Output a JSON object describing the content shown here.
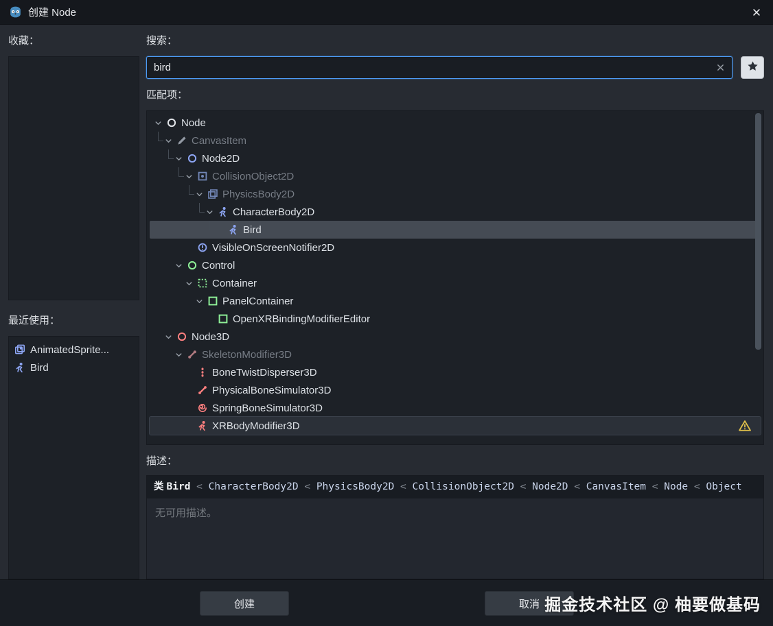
{
  "window": {
    "title": "创建 Node"
  },
  "favorites": {
    "label": "收藏："
  },
  "recent": {
    "label": "最近使用：",
    "items": [
      {
        "label": "AnimatedSprite...",
        "icon": "sprite-frames-icon",
        "color": "#8da5f3"
      },
      {
        "label": "Bird",
        "icon": "person-icon",
        "color": "#8da5f3"
      }
    ]
  },
  "search": {
    "label": "搜索：",
    "value": "bird"
  },
  "matches": {
    "label": "匹配项：",
    "rows": [
      {
        "label": "Node",
        "icon": "circle-icon",
        "color": "#e3e6ea",
        "level": 0,
        "chevron": true
      },
      {
        "label": "CanvasItem",
        "icon": "brush-icon",
        "color": "#9299a3",
        "level": 1,
        "chevron": true,
        "connector": true,
        "muted": true
      },
      {
        "label": "Node2D",
        "icon": "circle-icon",
        "color": "#8da5f3",
        "level": 2,
        "chevron": true,
        "connector": true
      },
      {
        "label": "CollisionObject2D",
        "icon": "square-circle-icon",
        "color": "#7287b8",
        "level": 3,
        "chevron": true,
        "connector": true,
        "muted": true
      },
      {
        "label": "PhysicsBody2D",
        "icon": "squares-icon",
        "color": "#7287b8",
        "level": 4,
        "chevron": true,
        "connector": true,
        "muted": true
      },
      {
        "label": "CharacterBody2D",
        "icon": "person-icon",
        "color": "#8da5f3",
        "level": 5,
        "chevron": true,
        "connector": true
      },
      {
        "label": "Bird",
        "icon": "person-icon",
        "color": "#8da5f3",
        "level": 6,
        "connector": true,
        "selected": true
      },
      {
        "label": "VisibleOnScreenNotifier2D",
        "icon": "alert-circle-icon",
        "color": "#8da5f3",
        "level": 3
      },
      {
        "label": "Control",
        "icon": "circle-icon",
        "color": "#8eef97",
        "level": 2,
        "chevron": true
      },
      {
        "label": "Container",
        "icon": "dotted-square-icon",
        "color": "#8eef97",
        "level": 3,
        "chevron": true
      },
      {
        "label": "PanelContainer",
        "icon": "square-icon",
        "color": "#8eef97",
        "level": 4,
        "chevron": true
      },
      {
        "label": "OpenXRBindingModifierEditor",
        "icon": "square-icon",
        "color": "#8eef97",
        "level": 5
      },
      {
        "label": "Node3D",
        "icon": "circle-icon",
        "color": "#fc7f7f",
        "level": 1,
        "chevron": true
      },
      {
        "label": "SkeletonModifier3D",
        "icon": "skeleton-icon",
        "color": "#b07a80",
        "level": 2,
        "chevron": true,
        "muted": true
      },
      {
        "label": "BoneTwistDisperser3D",
        "icon": "bone-stack-icon",
        "color": "#fc7f7f",
        "level": 3
      },
      {
        "label": "PhysicalBoneSimulator3D",
        "icon": "bone-icon",
        "color": "#fc7f7f",
        "level": 3
      },
      {
        "label": "SpringBoneSimulator3D",
        "icon": "spring-icon",
        "color": "#fc7f7f",
        "level": 3
      },
      {
        "label": "XRBodyModifier3D",
        "icon": "person-icon",
        "color": "#fc7f7f",
        "level": 3,
        "hover": true,
        "warning": true
      }
    ]
  },
  "description": {
    "label": "描述：",
    "class_word": "类",
    "class_name": "Bird",
    "separator": "<",
    "ancestors": [
      "CharacterBody2D",
      "PhysicsBody2D",
      "CollisionObject2D",
      "Node2D",
      "CanvasItem",
      "Node",
      "Object"
    ],
    "empty_text": "无可用描述。"
  },
  "actions": {
    "create": "创建",
    "cancel": "取消"
  },
  "watermark": "掘金技术社区 @ 柚要做基码",
  "colors": {
    "node2d_blue": "#8da5f3",
    "control_green": "#8eef97",
    "node3d_red": "#fc7f7f",
    "warning_yellow": "#e0c04a",
    "focus_blue": "#4d9bf5",
    "selection_gray": "#454b54"
  }
}
